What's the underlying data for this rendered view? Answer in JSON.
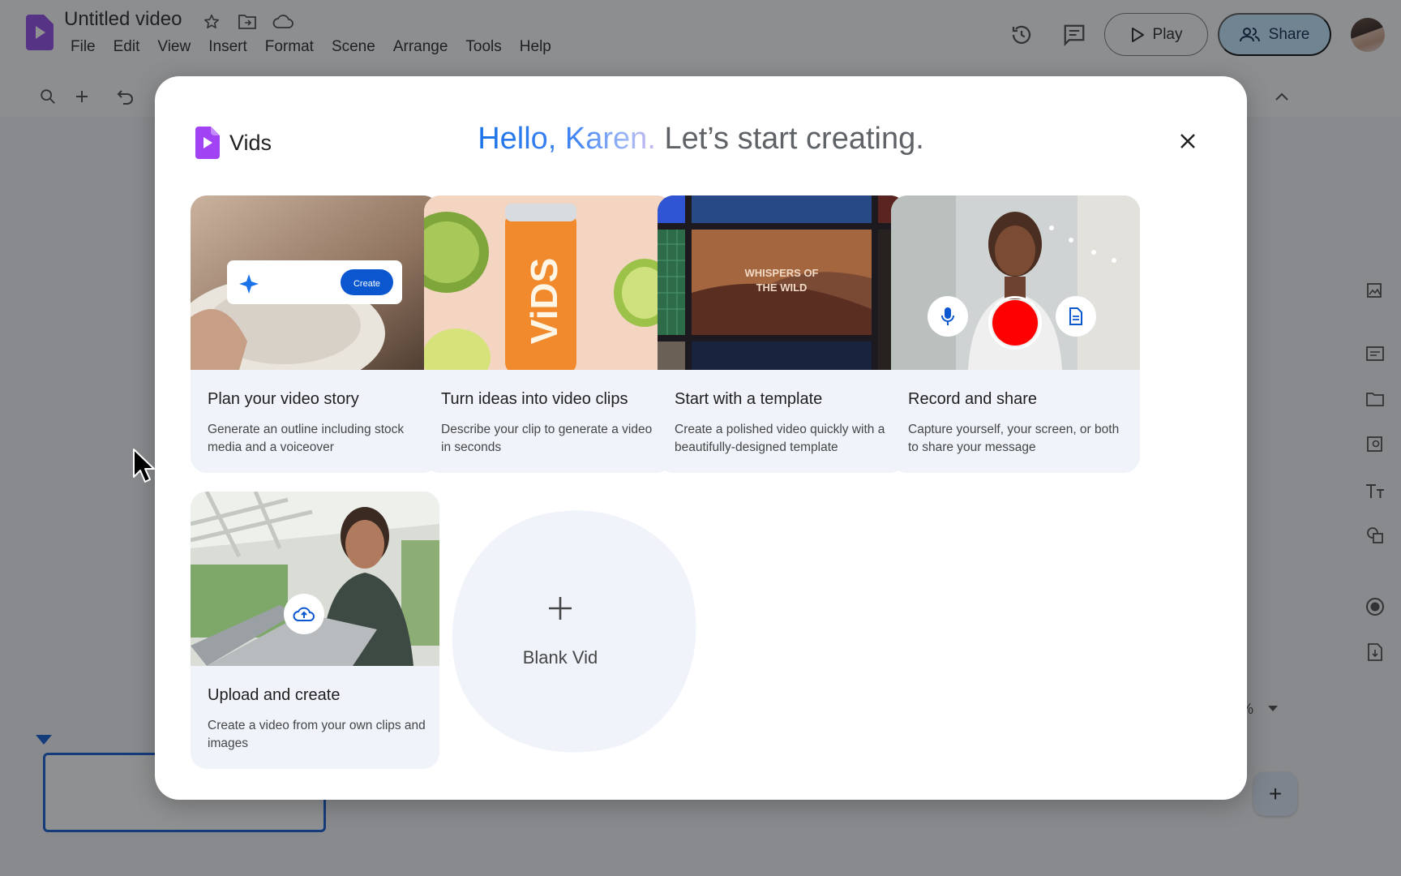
{
  "app": {
    "doc_title": "Untitled video",
    "menu": [
      "File",
      "Edit",
      "View",
      "Insert",
      "Format",
      "Scene",
      "Arrange",
      "Tools",
      "Help"
    ],
    "play_label": "Play",
    "share_label": "Share",
    "zoom_text": "%",
    "add_scene_label": "+"
  },
  "dialog": {
    "logo_text": "Vids",
    "greeting_hello": "Hello, Karen.",
    "greeting_rest": "Let’s start creating.",
    "cards": [
      {
        "title": "Plan your video story",
        "desc": "Generate an outline including stock media and a voiceover",
        "button": "Create"
      },
      {
        "title": "Turn ideas into video clips",
        "desc": "Describe your clip to generate a video in seconds",
        "can_text": "ViDS"
      },
      {
        "title": "Start with a template",
        "desc": "Create a polished video quickly with a beautifully-designed template",
        "template_text_1": "WHISPERS OF",
        "template_text_2": "THE WILD"
      },
      {
        "title": "Record and share",
        "desc": "Capture yourself, your screen, or both to share your message"
      },
      {
        "title": "Upload and create",
        "desc": "Create a video from your own clips and images"
      }
    ],
    "blank_label": "Blank Vid"
  },
  "colors": {
    "accent_blue": "#0b57d0",
    "vids_purple": "#a142f4",
    "record_red": "#ff0000"
  }
}
